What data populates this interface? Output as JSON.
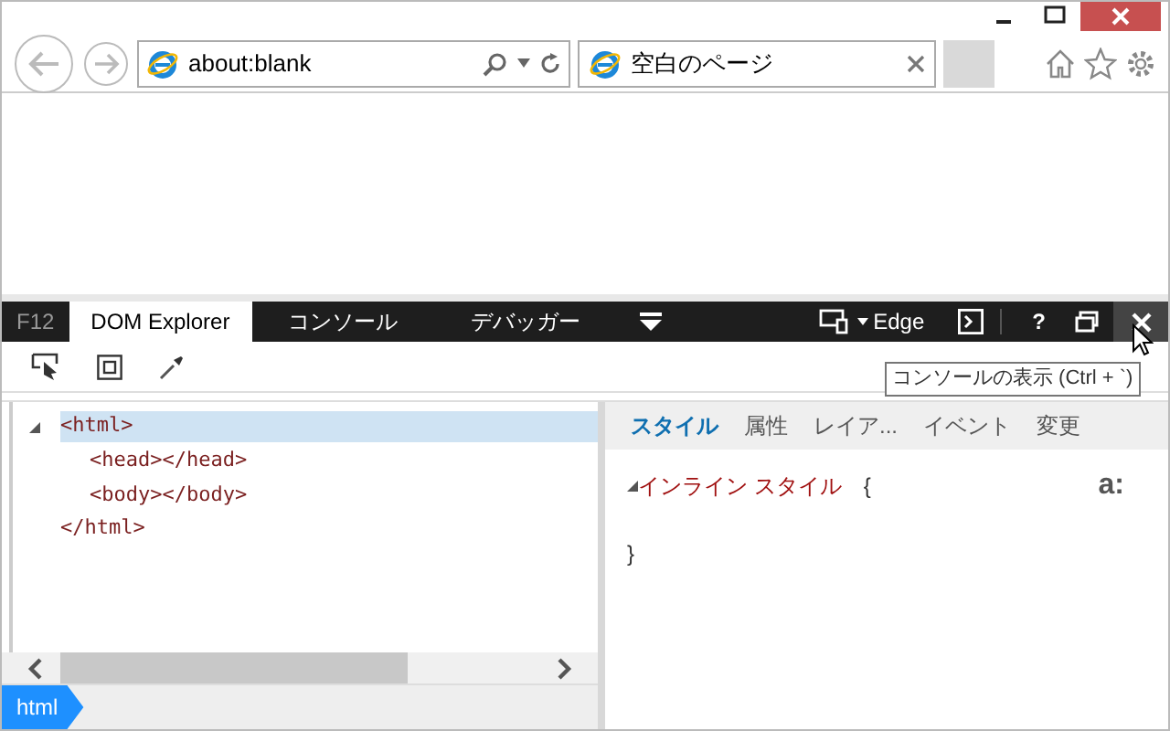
{
  "browser": {
    "address": "about:blank",
    "tabs": [
      {
        "title": "空白のページ",
        "selected": true
      }
    ]
  },
  "devtools": {
    "badge": "F12",
    "tabs": [
      {
        "label": "DOM Explorer",
        "selected": true
      },
      {
        "label": "コンソール",
        "selected": false
      },
      {
        "label": "デバッガー",
        "selected": false
      }
    ],
    "emulation": "Edge",
    "help": "?",
    "tooltip": "コンソールの表示 (Ctrl + `)",
    "dom_tree": [
      {
        "open": "<html>",
        "close": "</html>",
        "expanded": true,
        "selected": true,
        "children": [
          {
            "open": "<head></head>",
            "selected": false
          },
          {
            "open": "<body></body>",
            "selected": false
          }
        ]
      }
    ],
    "breadcrumb": [
      "html"
    ],
    "style_tabs": [
      {
        "label": "スタイル",
        "selected": true
      },
      {
        "label": "属性",
        "selected": false
      },
      {
        "label": "レイア...",
        "selected": false
      },
      {
        "label": "イベント",
        "selected": false
      },
      {
        "label": "変更",
        "selected": false
      }
    ],
    "styles": {
      "section": "インライン スタイル",
      "expanded": true,
      "open_brace": "{",
      "close_brace": "}",
      "toggle": "a:"
    }
  }
}
